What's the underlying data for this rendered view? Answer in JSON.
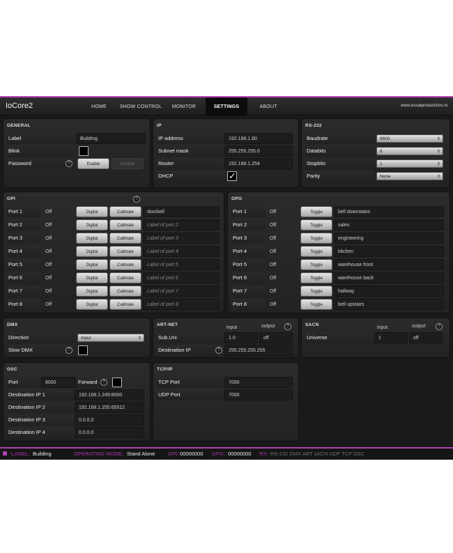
{
  "header": {
    "title": "IoCore2",
    "tabs": [
      {
        "label": "HOME"
      },
      {
        "label": "SHOW CONTROL"
      },
      {
        "label": "MONITOR"
      },
      {
        "label": "SETTINGS",
        "active": true
      },
      {
        "label": "ABOUT"
      }
    ],
    "site": "www.visualproductions.nl"
  },
  "general": {
    "title": "GENERAL",
    "label_label": "Label",
    "label_value": "Building",
    "blink_label": "Blink",
    "password_label": "Password",
    "enable_label": "Enable",
    "disable_label": "Disable"
  },
  "ip": {
    "title": "IP",
    "address_label": "IP address",
    "address_value": "192.168.1.80",
    "mask_label": "Subnet mask",
    "mask_value": "255.255.255.0",
    "router_label": "Router",
    "router_value": "192.168.1.254",
    "dhcp_label": "DHCP",
    "dhcp_checked": true
  },
  "rs232": {
    "title": "RS-232",
    "baud_label": "Baudrate",
    "baud_value": "9600",
    "databits_label": "Databits",
    "databits_value": "8",
    "stopbits_label": "Stopbits",
    "stopbits_value": "1",
    "parity_label": "Parity",
    "parity_value": "None"
  },
  "gpi": {
    "title": "GPI",
    "digital_label": "Digital",
    "calibrate_label": "Calibrate",
    "ports": [
      {
        "name": "Port 1",
        "state": "Off",
        "label": "doorbell",
        "placeholder": false
      },
      {
        "name": "Port 2",
        "state": "Off",
        "label": "Label of port 2",
        "placeholder": true
      },
      {
        "name": "Port 3",
        "state": "Off",
        "label": "Label of port 3",
        "placeholder": true
      },
      {
        "name": "Port 4",
        "state": "Off",
        "label": "Label of port 4",
        "placeholder": true
      },
      {
        "name": "Port 5",
        "state": "Off",
        "label": "Label of port 5",
        "placeholder": true
      },
      {
        "name": "Port 6",
        "state": "Off",
        "label": "Label of port 6",
        "placeholder": true
      },
      {
        "name": "Port 7",
        "state": "Off",
        "label": "Label of port 7",
        "placeholder": true
      },
      {
        "name": "Port 8",
        "state": "Off",
        "label": "Label of port 8",
        "placeholder": true
      }
    ]
  },
  "gpo": {
    "title": "GPO",
    "toggle_label": "Toggle",
    "ports": [
      {
        "name": "Port 1",
        "state": "Off",
        "label": "bell downstairs"
      },
      {
        "name": "Port 2",
        "state": "Off",
        "label": "sales"
      },
      {
        "name": "Port 3",
        "state": "Off",
        "label": "engineering"
      },
      {
        "name": "Port 4",
        "state": "Off",
        "label": "kitchen"
      },
      {
        "name": "Port 5",
        "state": "Off",
        "label": "warehouse front"
      },
      {
        "name": "Port 6",
        "state": "Off",
        "label": "warehouse back"
      },
      {
        "name": "Port 7",
        "state": "Off",
        "label": "hallway"
      },
      {
        "name": "Port 8",
        "state": "Off",
        "label": "bell upstairs"
      }
    ]
  },
  "dmx": {
    "title": "DMX",
    "direction_label": "Direction",
    "direction_value": "Input",
    "slow_label": "Slow DMX"
  },
  "artnet": {
    "title": "ART-NET",
    "input_head": "input",
    "output_head": "output",
    "subuni_label": "Sub.Uni",
    "subuni_input": "1.0",
    "subuni_output": "off",
    "dest_label": "Destination IP",
    "dest_value": "255.255.255.255"
  },
  "sacn": {
    "title": "SACN",
    "input_head": "input",
    "output_head": "output",
    "universe_label": "Universe",
    "universe_input": "1",
    "universe_output": "off"
  },
  "osc": {
    "title": "OSC",
    "port_label": "Port",
    "port_value": "8000",
    "forward_label": "Forward",
    "dests": [
      {
        "label": "Destination IP 1",
        "value": "192.168.1.249:8000"
      },
      {
        "label": "Destination IP 2",
        "value": "192.168.1.255:65512"
      },
      {
        "label": "Destination IP 3",
        "value": "0.0.0.0"
      },
      {
        "label": "Destination IP 4",
        "value": "0.0.0.0"
      }
    ]
  },
  "tcpip": {
    "title": "TCP/IP",
    "tcp_label": "TCP Port",
    "tcp_value": "7000",
    "udp_label": "UDP Port",
    "udp_value": "7000"
  },
  "status": {
    "label_key": "LABEL:",
    "label_value": "Building",
    "mode_key": "OPERATING MODE:",
    "mode_value": "Stand Alone",
    "gpi_key": "GPI:",
    "gpi_value": "00000000",
    "gpo_key": "GPO:",
    "gpo_value": "00000000",
    "rx_key": "RX:",
    "rx_value": "RS-232 DMX ART sACN UDP TCP OSC"
  },
  "colors": {
    "accent": "#b13fb0",
    "background": "#1a1a1a"
  }
}
